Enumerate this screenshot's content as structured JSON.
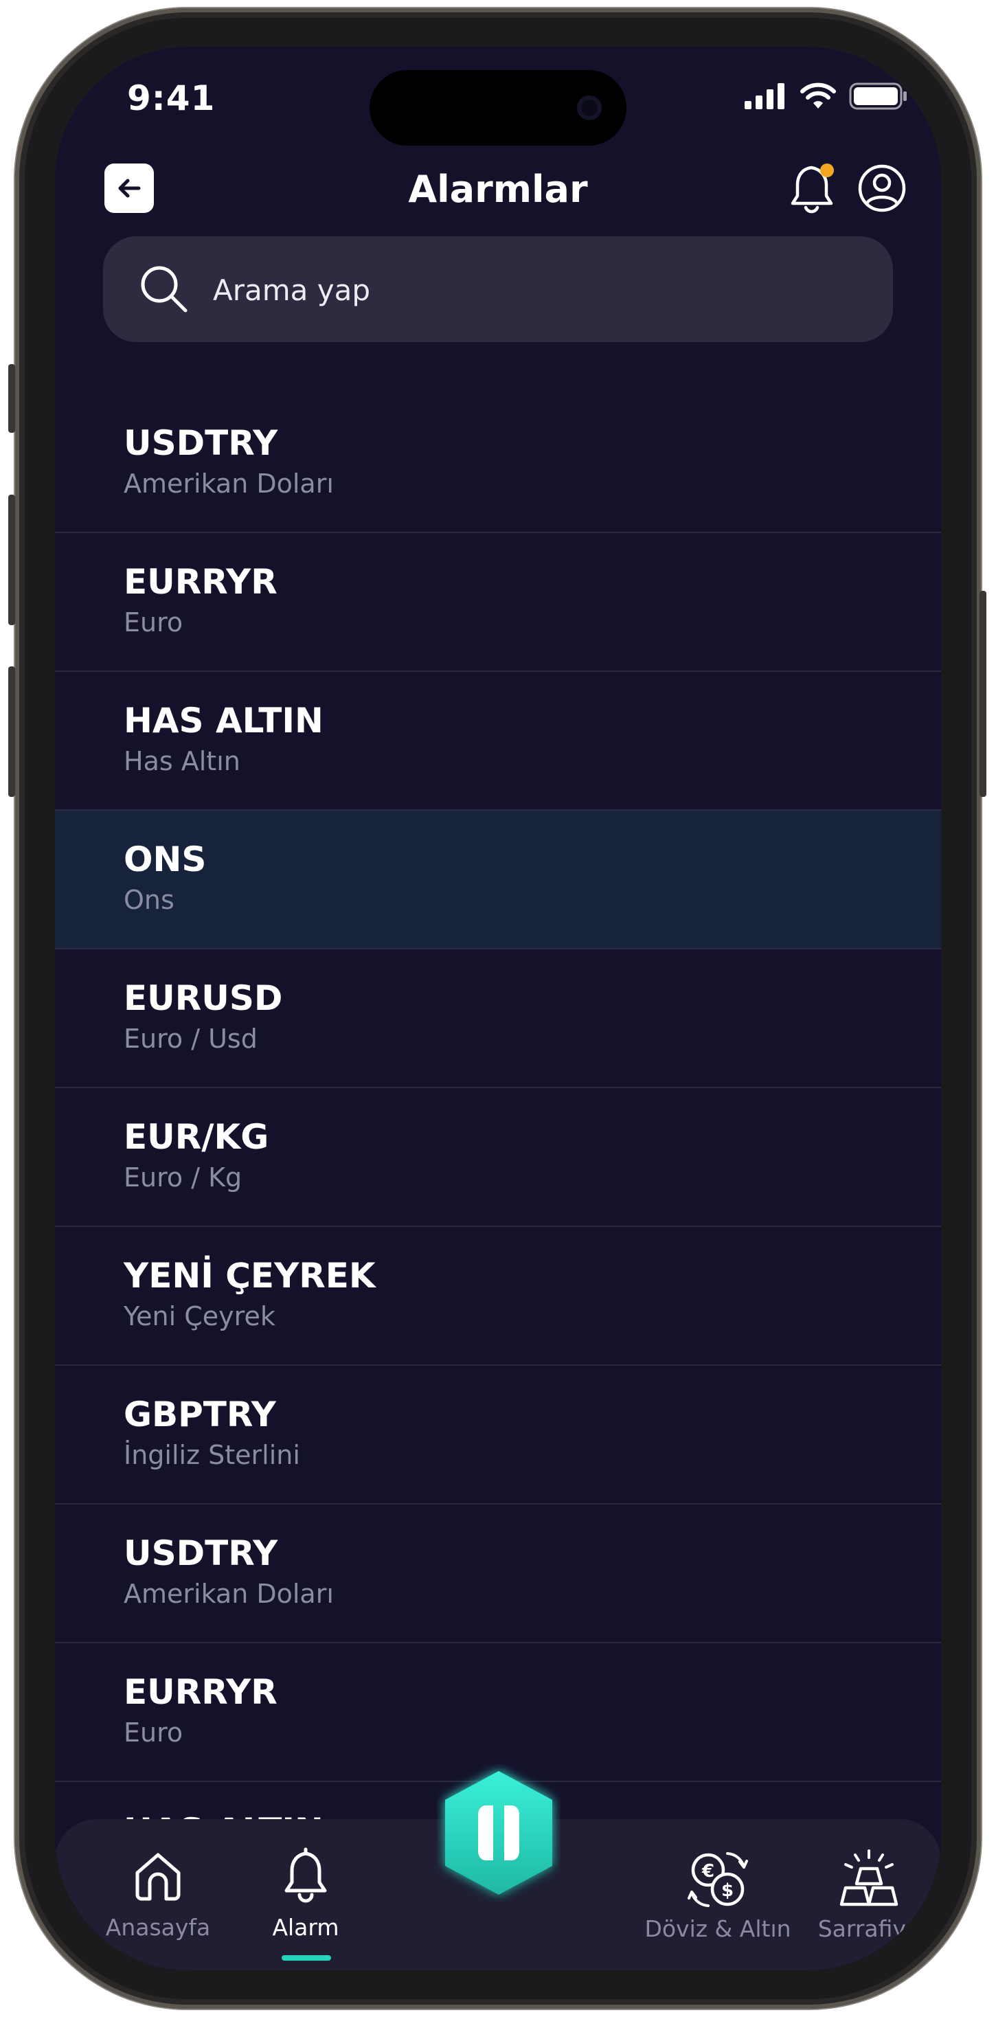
{
  "status": {
    "time": "9:41"
  },
  "header": {
    "title": "Alarmlar"
  },
  "search": {
    "placeholder": "Arama yap"
  },
  "list": [
    {
      "code": "USDTRY",
      "name": "Amerikan Doları"
    },
    {
      "code": "EURRYR",
      "name": "Euro"
    },
    {
      "code": "HAS ALTIN",
      "name": "Has Altın"
    },
    {
      "code": "ONS",
      "name": "Ons",
      "selected": true
    },
    {
      "code": "EURUSD",
      "name": "Euro / Usd"
    },
    {
      "code": "EUR/KG",
      "name": "Euro / Kg"
    },
    {
      "code": "YENİ ÇEYREK",
      "name": "Yeni Çeyrek"
    },
    {
      "code": "GBPTRY",
      "name": "İngiliz Sterlini"
    },
    {
      "code": "USDTRY",
      "name": "Amerikan Doları"
    },
    {
      "code": "EURRYR",
      "name": "Euro"
    },
    {
      "code": "HAS ALTIN",
      "name": ""
    }
  ],
  "tabbar": {
    "items": [
      {
        "label": "Anasayfa",
        "icon": "home-icon"
      },
      {
        "label": "Alarm",
        "icon": "bell-icon",
        "active": true
      },
      {
        "label": "Döviz & Altın",
        "icon": "currency-exchange-icon"
      },
      {
        "label": "Sarrafiye",
        "icon": "gold-bars-icon"
      }
    ]
  },
  "colors": {
    "background": "#13122a",
    "accent": "#26d3bd",
    "selected_row": "#16233a",
    "notification_dot": "#f5a623"
  }
}
